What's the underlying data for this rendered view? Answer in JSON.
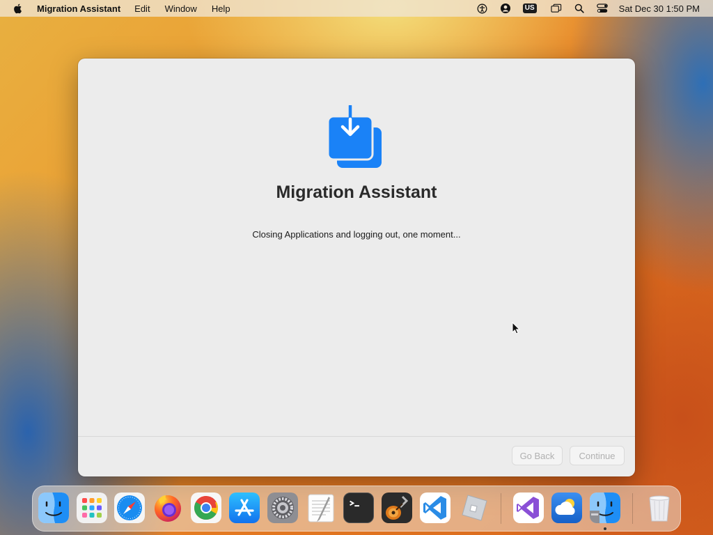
{
  "menubar": {
    "app_name": "Migration Assistant",
    "menus": [
      "Edit",
      "Window",
      "Help"
    ],
    "input_source": "US",
    "clock": "Sat Dec 30  1:50 PM",
    "status_icons": [
      "accessibility-icon",
      "user-account-icon",
      "input-source-icon",
      "screen-mirroring-icon",
      "spotlight-search-icon",
      "control-center-icon"
    ]
  },
  "window": {
    "title": "Migration Assistant",
    "status": "Closing Applications and logging out, one moment...",
    "icon": "migration-download-icon",
    "accent_color": "#1a82f7",
    "buttons": {
      "back": "Go Back",
      "continue": "Continue",
      "back_enabled": false,
      "continue_enabled": false
    }
  },
  "dock": {
    "apps": [
      {
        "name": "Finder",
        "icon": "finder-icon"
      },
      {
        "name": "Launchpad",
        "icon": "launchpad-icon"
      },
      {
        "name": "Safari",
        "icon": "safari-icon"
      },
      {
        "name": "Firefox",
        "icon": "firefox-icon"
      },
      {
        "name": "Google Chrome",
        "icon": "chrome-icon"
      },
      {
        "name": "App Store",
        "icon": "app-store-icon"
      },
      {
        "name": "System Settings",
        "icon": "system-settings-icon"
      },
      {
        "name": "TextEdit",
        "icon": "textedit-icon"
      },
      {
        "name": "Terminal",
        "icon": "terminal-icon"
      },
      {
        "name": "GarageBand",
        "icon": "garageband-icon"
      },
      {
        "name": "Visual Studio Code",
        "icon": "vscode-icon"
      },
      {
        "name": "Roblox",
        "icon": "roblox-icon"
      },
      {
        "name": "Visual Studio",
        "icon": "visual-studio-icon"
      },
      {
        "name": "Weather",
        "icon": "weather-icon"
      },
      {
        "name": "Finder (Migration)",
        "icon": "finder-running-icon"
      },
      {
        "name": "Trash",
        "icon": "trash-icon"
      }
    ],
    "running_app": "Finder (Migration)"
  }
}
